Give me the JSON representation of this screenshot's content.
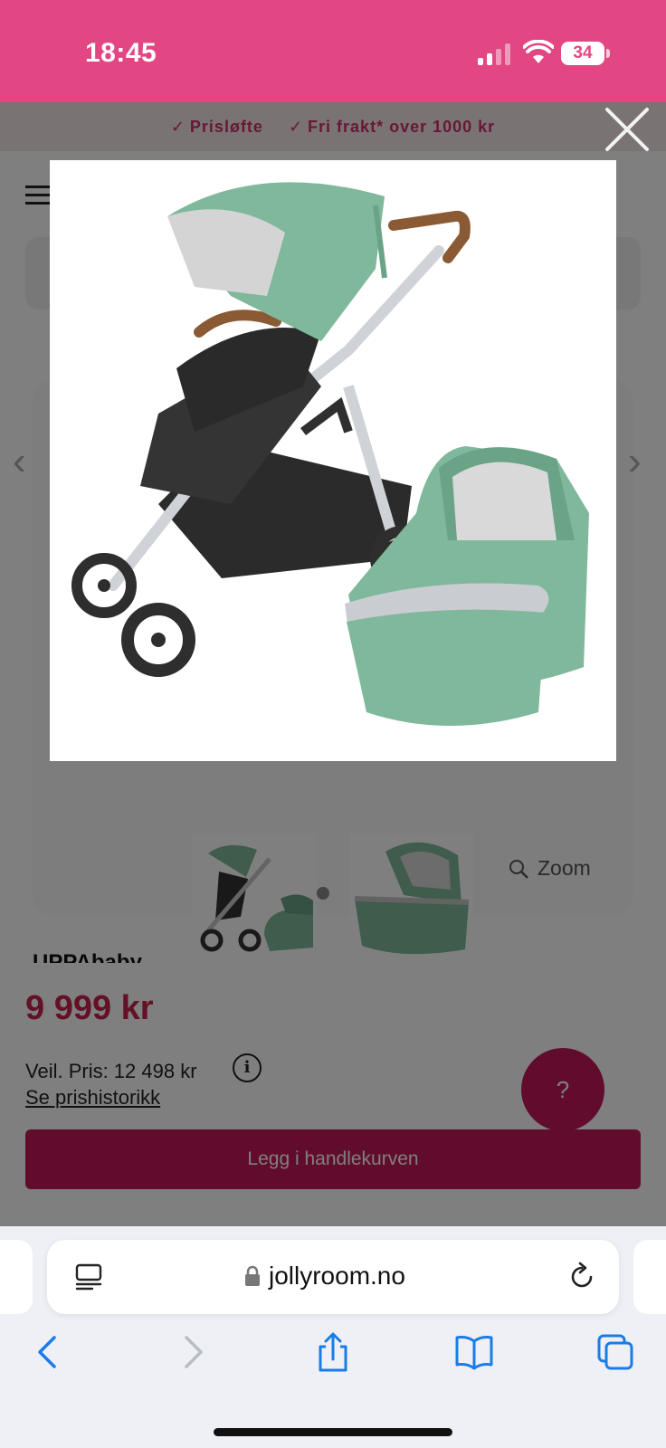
{
  "status_bar": {
    "time": "18:45",
    "battery": "34"
  },
  "promo": {
    "items": [
      "Prisløfte",
      "Fri frakt* over 1000 kr"
    ],
    "check_glyph": "✓"
  },
  "product": {
    "title_peek": "UPPAbaby",
    "price": "9 999 kr",
    "recommended_price": "Veil. Pris: 12 498 kr",
    "info_glyph": "i",
    "price_history_link": "Se prishistorikk",
    "zoom_label": "Zoom",
    "add_to_cart": "Legg i handlekurven",
    "help_label": "?",
    "carousel_prev": "‹",
    "carousel_next": "›"
  },
  "browser": {
    "url": "jollyroom.no"
  },
  "colors": {
    "brand_pink": "#e24683",
    "price_red": "#c9234f",
    "button_magenta": "#c2185b",
    "stroller_green": "#7fb89a",
    "ios_blue": "#1a7ce6"
  },
  "icons": [
    "close-icon",
    "menu-icon",
    "search-zoom-icon",
    "reader-icon",
    "lock-icon",
    "reload-icon",
    "back-icon",
    "forward-icon",
    "share-icon",
    "bookmarks-icon",
    "tabs-icon"
  ]
}
